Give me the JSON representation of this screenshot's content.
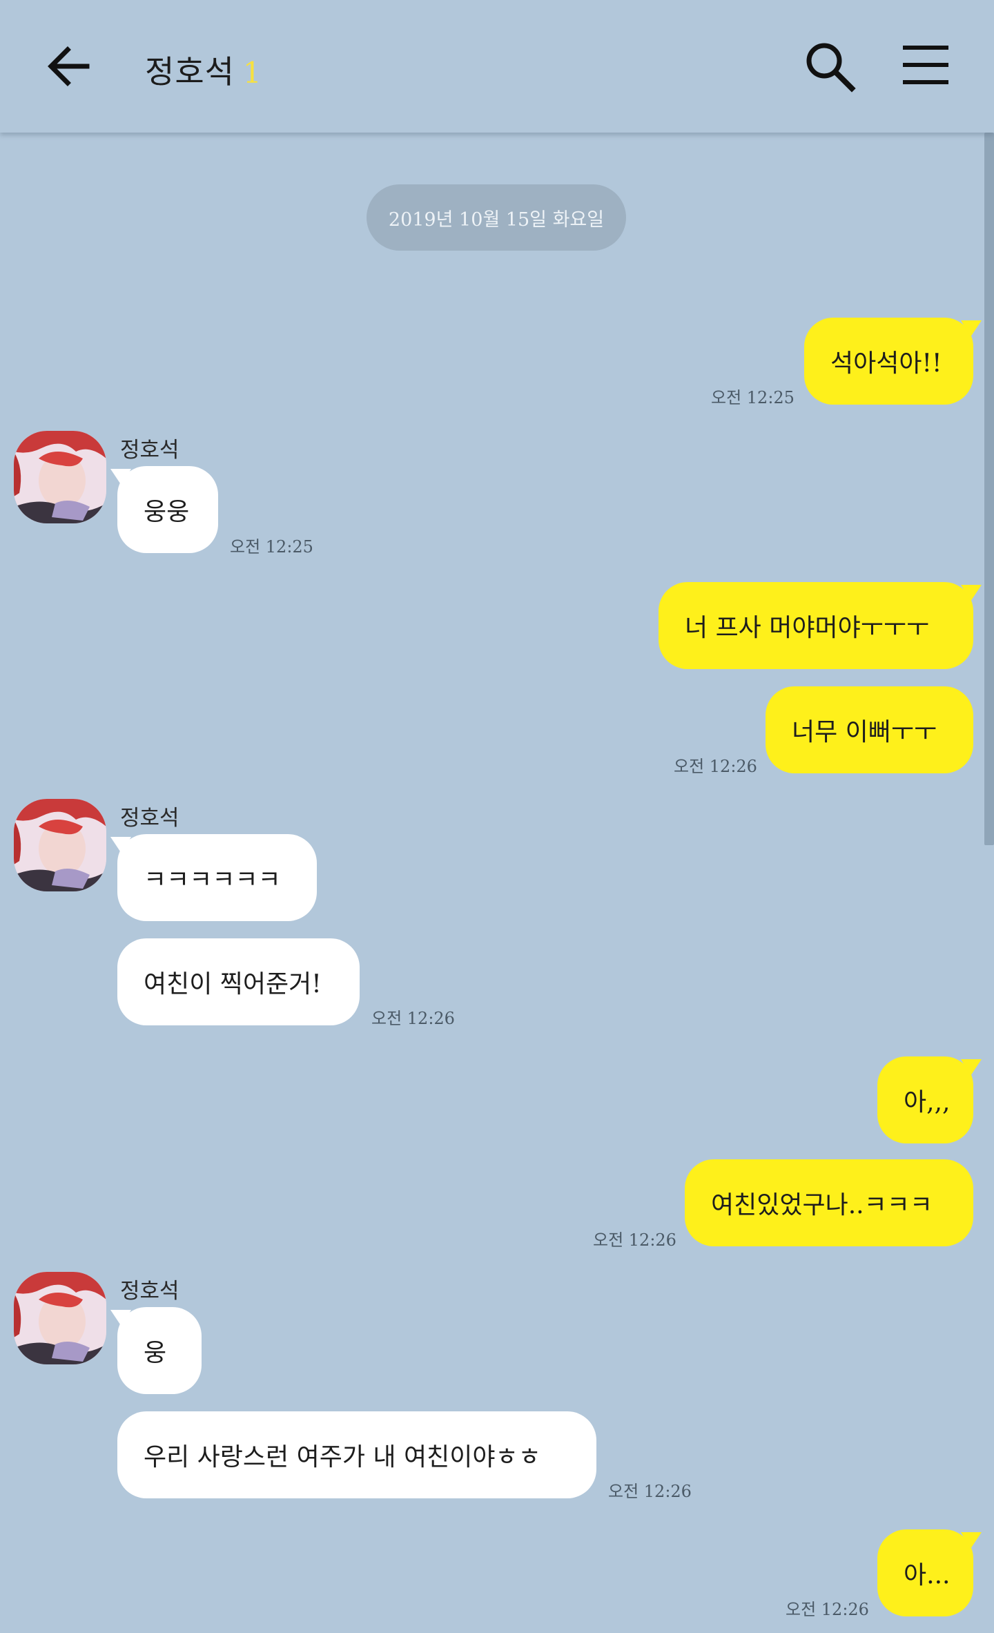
{
  "header": {
    "title": "정호석",
    "unread_count": "1"
  },
  "date_divider": "2019년 10월 15일 화요일",
  "sender_name": "정호석",
  "messages": {
    "m1": "석아석아!!",
    "t1": "오전 12:25",
    "m2": "웅웅",
    "t2": "오전 12:25",
    "m3": "너 프사 머야머야ㅜㅜㅜ",
    "m4": "너무 이뻐ㅜㅜ",
    "t4": "오전 12:26",
    "m5": "ㅋㅋㅋㅋㅋㅋ",
    "m6": "여친이 찍어준거!",
    "t6": "오전 12:26",
    "m7": "아,,,",
    "m8": "여친있었구나..ㅋㅋㅋ",
    "t8": "오전 12:26",
    "m9": "웅",
    "m10": "우리 사랑스런 여주가 내 여친이야ㅎㅎ",
    "t10": "오전 12:26",
    "m11": "아...",
    "t11": "오전 12:26"
  },
  "colors": {
    "background": "#b2c7da",
    "my_bubble": "#fef01b",
    "their_bubble": "#ffffff",
    "unread_count": "#f7e13f"
  },
  "icons": [
    "back-arrow-icon",
    "search-icon",
    "menu-icon"
  ]
}
